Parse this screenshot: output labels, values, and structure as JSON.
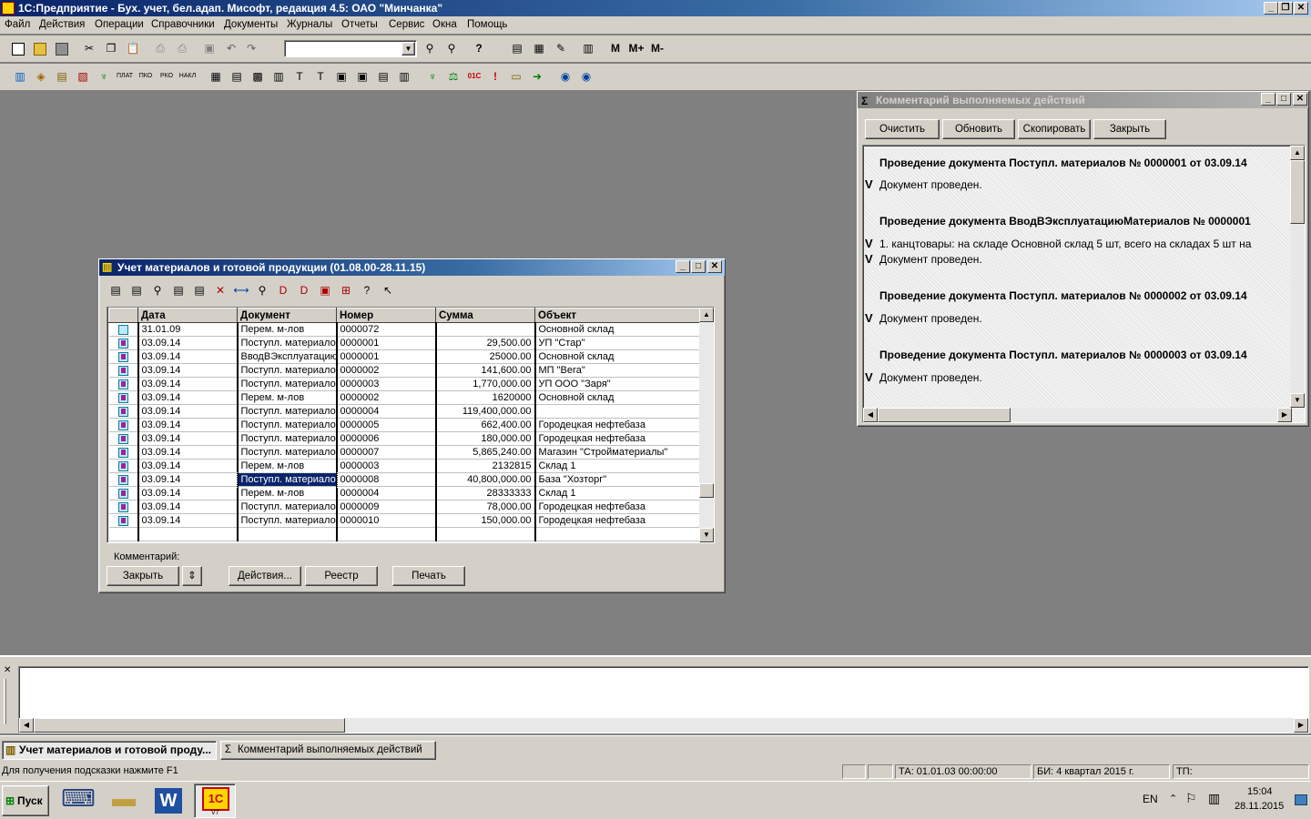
{
  "app": {
    "title": "1С:Предприятие - Бух. учет, бел.адап. Мисофт, редакция 4.5: ОАО \"Минчанка\""
  },
  "menu": [
    "Файл",
    "Действия",
    "Операции",
    "Справочники",
    "Документы",
    "Журналы",
    "Отчеты",
    "Сервис",
    "Окна",
    "Помощь"
  ],
  "toolbar": {
    "m_labels": [
      "M",
      "M+",
      "M-"
    ]
  },
  "journal": {
    "title": "Учет материалов и готовой продукции (01.08.00-28.11.15)",
    "columns": [
      "Дата",
      "Документ",
      "Номер",
      "Сумма",
      "Объект"
    ],
    "rows": [
      {
        "date": "31.01.09",
        "doc": "Перем. м-лов",
        "num": "0000072",
        "sum": "",
        "obj": "Основной склад",
        "posted": false
      },
      {
        "date": "03.09.14",
        "doc": "Поступл. материалов",
        "num": "0000001",
        "sum": "29,500.00",
        "obj": "УП \"Стар\"",
        "posted": true
      },
      {
        "date": "03.09.14",
        "doc": "ВводВЭксплуатацию",
        "num": "0000001",
        "sum": "25000.00",
        "obj": "Основной склад",
        "posted": true
      },
      {
        "date": "03.09.14",
        "doc": "Поступл. материалов",
        "num": "0000002",
        "sum": "141,600.00",
        "obj": "МП \"Вега\"",
        "posted": true
      },
      {
        "date": "03.09.14",
        "doc": "Поступл. материалов",
        "num": "0000003",
        "sum": "1,770,000.00",
        "obj": "УП ООО \"Заря\"",
        "posted": true
      },
      {
        "date": "03.09.14",
        "doc": "Перем. м-лов",
        "num": "0000002",
        "sum": "1620000",
        "obj": "Основной склад",
        "posted": true
      },
      {
        "date": "03.09.14",
        "doc": "Поступл. материалов",
        "num": "0000004",
        "sum": "119,400,000.00",
        "obj": "",
        "posted": true
      },
      {
        "date": "03.09.14",
        "doc": "Поступл. материалов",
        "num": "0000005",
        "sum": "662,400.00",
        "obj": "Городецкая нефтебаза",
        "posted": true
      },
      {
        "date": "03.09.14",
        "doc": "Поступл. материалов",
        "num": "0000006",
        "sum": "180,000.00",
        "obj": "Городецкая нефтебаза",
        "posted": true
      },
      {
        "date": "03.09.14",
        "doc": "Поступл. материалов",
        "num": "0000007",
        "sum": "5,865,240.00",
        "obj": "Магазин \"Стройматериалы\"",
        "posted": true
      },
      {
        "date": "03.09.14",
        "doc": "Перем. м-лов",
        "num": "0000003",
        "sum": "2132815",
        "obj": "Склад 1",
        "posted": true
      },
      {
        "date": "03.09.14",
        "doc": "Поступл. материалов",
        "num": "0000008",
        "sum": "40,800,000.00",
        "obj": "База \"Хозторг\"",
        "posted": true,
        "selected": true
      },
      {
        "date": "03.09.14",
        "doc": "Перем. м-лов",
        "num": "0000004",
        "sum": "28333333",
        "obj": "Склад 1",
        "posted": true
      },
      {
        "date": "03.09.14",
        "doc": "Поступл. материалов",
        "num": "0000009",
        "sum": "78,000.00",
        "obj": "Городецкая нефтебаза",
        "posted": true
      },
      {
        "date": "03.09.14",
        "doc": "Поступл. материалов",
        "num": "0000010",
        "sum": "150,000.00",
        "obj": "Городецкая нефтебаза",
        "posted": true
      }
    ],
    "comment_label": "Комментарий:",
    "buttons": {
      "close": "Закрыть",
      "actions": "Действия...",
      "registry": "Реестр",
      "print": "Печать"
    }
  },
  "log": {
    "title": "Комментарий выполняемых действий",
    "buttons": {
      "clear": "Очистить",
      "refresh": "Обновить",
      "copy": "Скопировать",
      "close": "Закрыть"
    },
    "entries": [
      {
        "type": "h",
        "text": "Проведение документа Поступл. материалов № 0000001 от 03.09.14"
      },
      {
        "type": "v",
        "mark": "V",
        "text": "Документ проведен."
      },
      {
        "type": "h",
        "text": "Проведение документа ВводВЭксплуатациюМатериалов № 0000001"
      },
      {
        "type": "v",
        "mark": "V",
        "text": "1. канцтовары: на складе Основной склад 5 шт, всего на складах 5 шт на"
      },
      {
        "type": "v",
        "mark": "V",
        "text": "Документ проведен."
      },
      {
        "type": "h",
        "text": "Проведение документа Поступл. материалов № 0000002 от 03.09.14"
      },
      {
        "type": "v",
        "mark": "V",
        "text": "Документ проведен."
      },
      {
        "type": "h",
        "text": "Проведение документа Поступл. материалов № 0000003 от 03.09.14"
      },
      {
        "type": "v",
        "mark": "V",
        "text": "Документ проведен."
      }
    ]
  },
  "window_tabs": [
    "Учет материалов и готовой проду...",
    "Комментарий выполняемых действий"
  ],
  "status": {
    "hint": "Для получения подсказки нажмите F1",
    "ta": "ТА: 01.01.03  00:00:00",
    "bi": "БИ: 4 квартал 2015 г.",
    "tp": "ТП:"
  },
  "taskbar": {
    "start": "Пуск",
    "lang": "EN",
    "time": "15:04",
    "date": "28.11.2015",
    "v7_label": "V7"
  }
}
